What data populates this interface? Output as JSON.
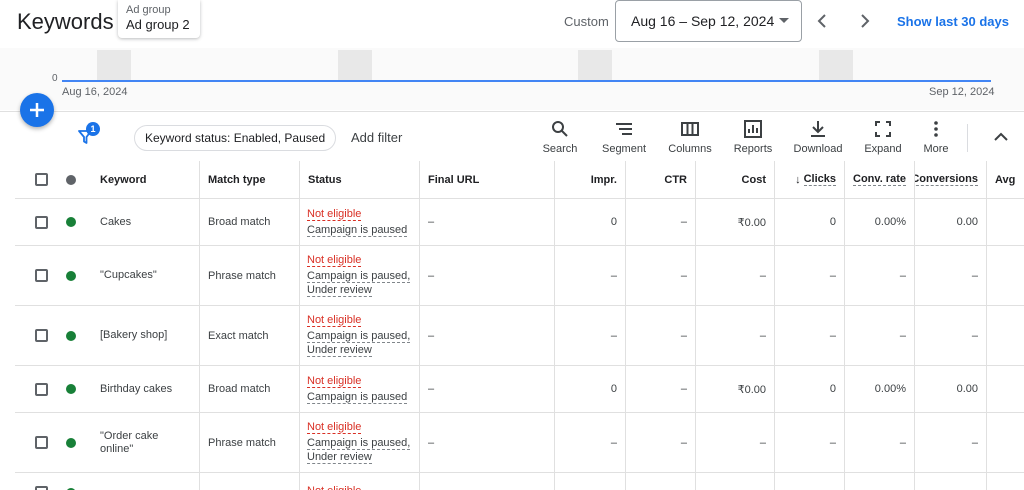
{
  "header": {
    "title": "Keywords",
    "ad_group_label": "Ad group",
    "ad_group_value": "Ad group 2",
    "custom_label": "Custom",
    "date_range": "Aug 16 – Sep 12, 2024",
    "show_last": "Show last 30 days"
  },
  "chart": {
    "zero_label": "0",
    "start_date": "Aug 16, 2024",
    "end_date": "Sep 12, 2024",
    "line_color": "#4285f4"
  },
  "toolbar": {
    "filter_count": "1",
    "status_chip": "Keyword status: Enabled, Paused",
    "add_filter": "Add filter",
    "buttons": [
      {
        "label": "Search",
        "icon": "search-icon"
      },
      {
        "label": "Segment",
        "icon": "segment-icon"
      },
      {
        "label": "Columns",
        "icon": "columns-icon"
      },
      {
        "label": "Reports",
        "icon": "reports-icon"
      },
      {
        "label": "Download",
        "icon": "download-icon"
      },
      {
        "label": "Expand",
        "icon": "expand-icon"
      },
      {
        "label": "More",
        "icon": "more-vert-icon"
      }
    ]
  },
  "table": {
    "headers": {
      "keyword": "Keyword",
      "match_type": "Match type",
      "status": "Status",
      "final_url": "Final URL",
      "impr": "Impr.",
      "ctr": "CTR",
      "cost": "Cost",
      "clicks": "Clicks",
      "conv_rate": "Conv. rate",
      "conversions": "Conversions",
      "avg": "Avg"
    },
    "rows": [
      {
        "keyword": "Cakes",
        "match_type": "Broad match",
        "status": "Not eligible",
        "reason": "Campaign is paused",
        "reason2": "",
        "final_url": "–",
        "impr": "0",
        "ctr": "–",
        "cost": "₹0.00",
        "clicks": "0",
        "conv_rate": "0.00%",
        "conversions": "0.00"
      },
      {
        "keyword": "\"Cupcakes\"",
        "match_type": "Phrase match",
        "status": "Not eligible",
        "reason": "Campaign is paused,",
        "reason2": "Under review",
        "final_url": "–",
        "impr": "–",
        "ctr": "–",
        "cost": "–",
        "clicks": "–",
        "conv_rate": "–",
        "conversions": "–"
      },
      {
        "keyword": "[Bakery shop]",
        "match_type": "Exact match",
        "status": "Not eligible",
        "reason": "Campaign is paused,",
        "reason2": "Under review",
        "final_url": "–",
        "impr": "–",
        "ctr": "–",
        "cost": "–",
        "clicks": "–",
        "conv_rate": "–",
        "conversions": "–"
      },
      {
        "keyword": "Birthday cakes",
        "match_type": "Broad match",
        "status": "Not eligible",
        "reason": "Campaign is paused",
        "reason2": "",
        "final_url": "–",
        "impr": "0",
        "ctr": "–",
        "cost": "₹0.00",
        "clicks": "0",
        "conv_rate": "0.00%",
        "conversions": "0.00"
      },
      {
        "keyword": "\"Order cake",
        "keyword2": "online\"",
        "match_type": "Phrase match",
        "status": "Not eligible",
        "reason": "Campaign is paused,",
        "reason2": "Under review",
        "final_url": "–",
        "impr": "–",
        "ctr": "–",
        "cost": "–",
        "clicks": "–",
        "conv_rate": "–",
        "conversions": "–"
      },
      {
        "keyword": "",
        "match_type": "",
        "status": "Not eligible",
        "reason": "",
        "reason2": "",
        "final_url": "",
        "impr": "",
        "ctr": "",
        "cost": "",
        "clicks": "",
        "conv_rate": "",
        "conversions": ""
      }
    ]
  },
  "colors": {
    "accent": "#1a73e8",
    "enabled_dot": "#188038",
    "error_text": "#d93025"
  }
}
